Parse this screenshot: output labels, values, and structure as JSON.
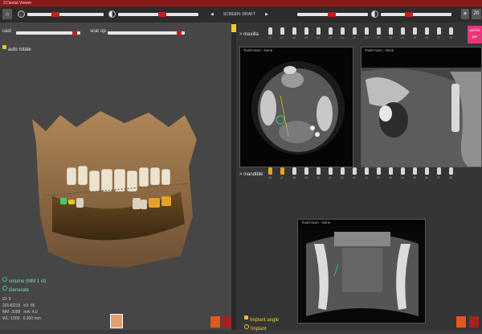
{
  "window": {
    "title": "3 Dental Viewer"
  },
  "toolbar": {
    "screen_label": "SCREEN: DRAFT",
    "sliders": [
      {
        "name": "slider-1",
        "value": 0.3
      },
      {
        "name": "slider-2",
        "value": 0.5
      },
      {
        "name": "slider-3",
        "value": 0.45
      },
      {
        "name": "slider-4",
        "value": 0.35
      }
    ],
    "right_value": "20"
  },
  "left": {
    "cast_label": "cast",
    "scar_label": "scar op",
    "auto_rotate_label": "auto rotate",
    "volume_label": "volume (MM 1 st)",
    "generate_label": "Generate",
    "info": {
      "line1": "ID: 0",
      "line2a": "20140215",
      "line2b": "kV: 85",
      "line3a": "MM: 3098",
      "line3b": "mA: 4.0",
      "line4a": "WL: 1000",
      "line4b": "0.300 mm"
    }
  },
  "right": {
    "maxilla_label": "> maxilla",
    "mandible_label": "> mandible",
    "anchor_button": "anchor pin",
    "vp1_title": "Tooth Num : None",
    "vp2_title": "Tooth Num : None",
    "vp3_title": "Tooth Num : None",
    "implant_angle_label": "Implant angle",
    "implant_label": "Implant",
    "maxilla_teeth": [
      "18",
      "17",
      "16",
      "15",
      "14",
      "13",
      "12",
      "11",
      "21",
      "22",
      "23",
      "24",
      "25",
      "26",
      "27",
      "28"
    ],
    "mandible_teeth": [
      "48",
      "47",
      "46",
      "45",
      "44",
      "43",
      "42",
      "41",
      "31",
      "32",
      "33",
      "34",
      "35",
      "36",
      "37",
      "38"
    ]
  },
  "colors": {
    "accent_red": "#c0201f",
    "gold": "#e3a328",
    "pink": "#e8357a",
    "orange": "#e0571f"
  }
}
